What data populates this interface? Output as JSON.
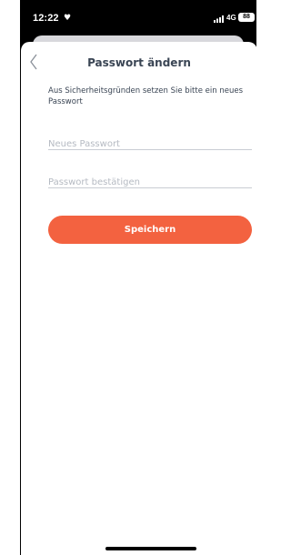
{
  "status_bar": {
    "time": "12:22",
    "network": "4G",
    "battery": "88"
  },
  "screen": {
    "title": "Passwort ändern",
    "description": "Aus Sicherheitsgründen setzen Sie bitte ein neues Passwort",
    "new_password_placeholder": "Neues Passwort",
    "confirm_password_placeholder": "Passwort bestätigen",
    "save_label": "Speichern"
  },
  "colors": {
    "accent": "#f36240",
    "text": "#3a4554",
    "placeholder": "#b5bac2"
  },
  "icons": [
    "heart-icon",
    "signal-icon",
    "battery-icon",
    "chevron-left-icon"
  ]
}
